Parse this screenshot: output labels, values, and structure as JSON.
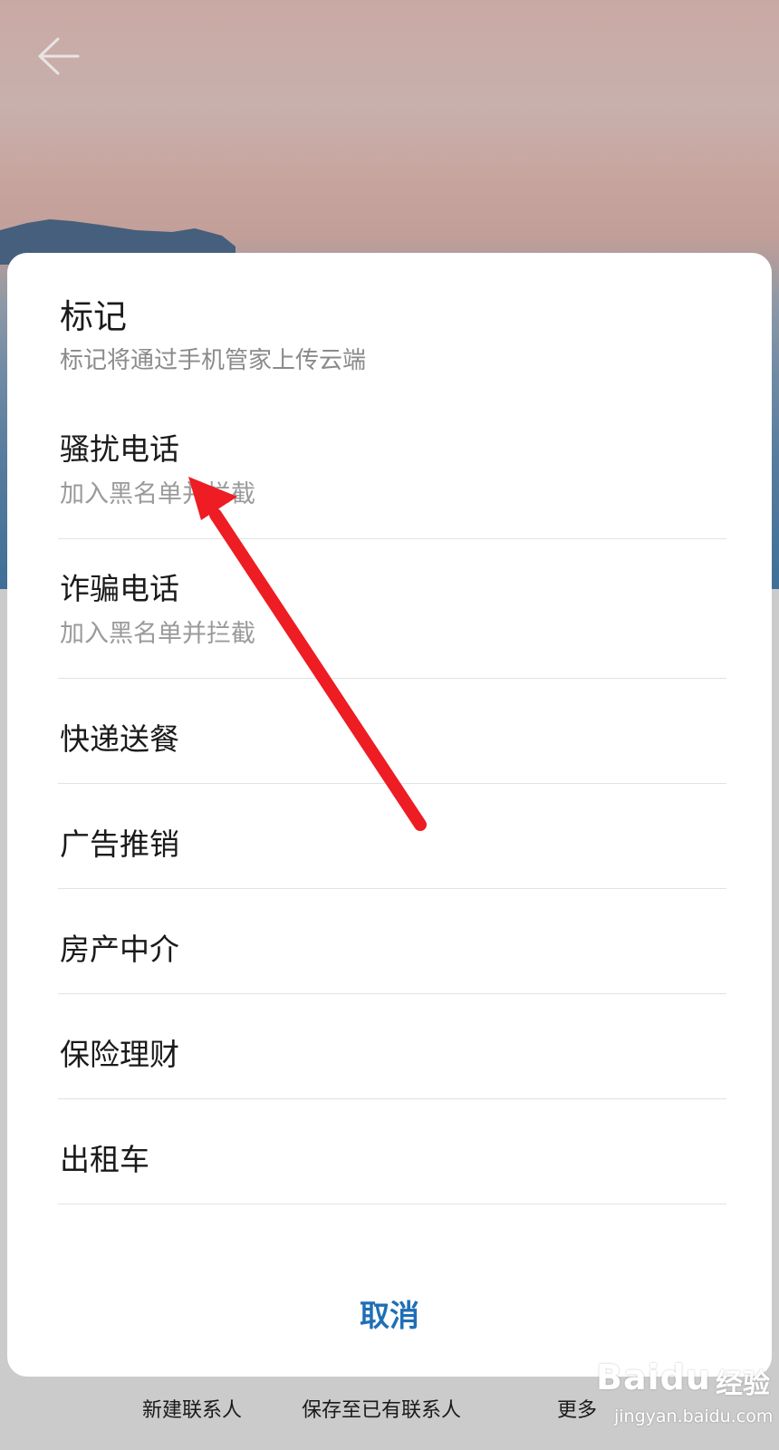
{
  "header": {
    "back_icon": "arrow-left-icon"
  },
  "dialog": {
    "title": "标记",
    "subtitle": "标记将通过手机管家上传云端",
    "options": [
      {
        "label": "骚扰电话",
        "description": "加入黑名单并拦截"
      },
      {
        "label": "诈骗电话",
        "description": "加入黑名单并拦截"
      },
      {
        "label": "快递送餐"
      },
      {
        "label": "广告推销"
      },
      {
        "label": "房产中介"
      },
      {
        "label": "保险理财"
      },
      {
        "label": "出租车"
      }
    ],
    "cancel_label": "取消"
  },
  "bottom_bar": {
    "items": [
      "新建联系人",
      "保存至已有联系人",
      "更多"
    ]
  },
  "annotation": {
    "arrow_color": "#ee1c23"
  },
  "watermark": {
    "brand": "Baidu",
    "jingyan": "经验",
    "url": "jingyan.baidu.com"
  },
  "colors": {
    "accent": "#1f6fb6",
    "sheet": "#ffffff",
    "annotation": "#ee1c23"
  }
}
